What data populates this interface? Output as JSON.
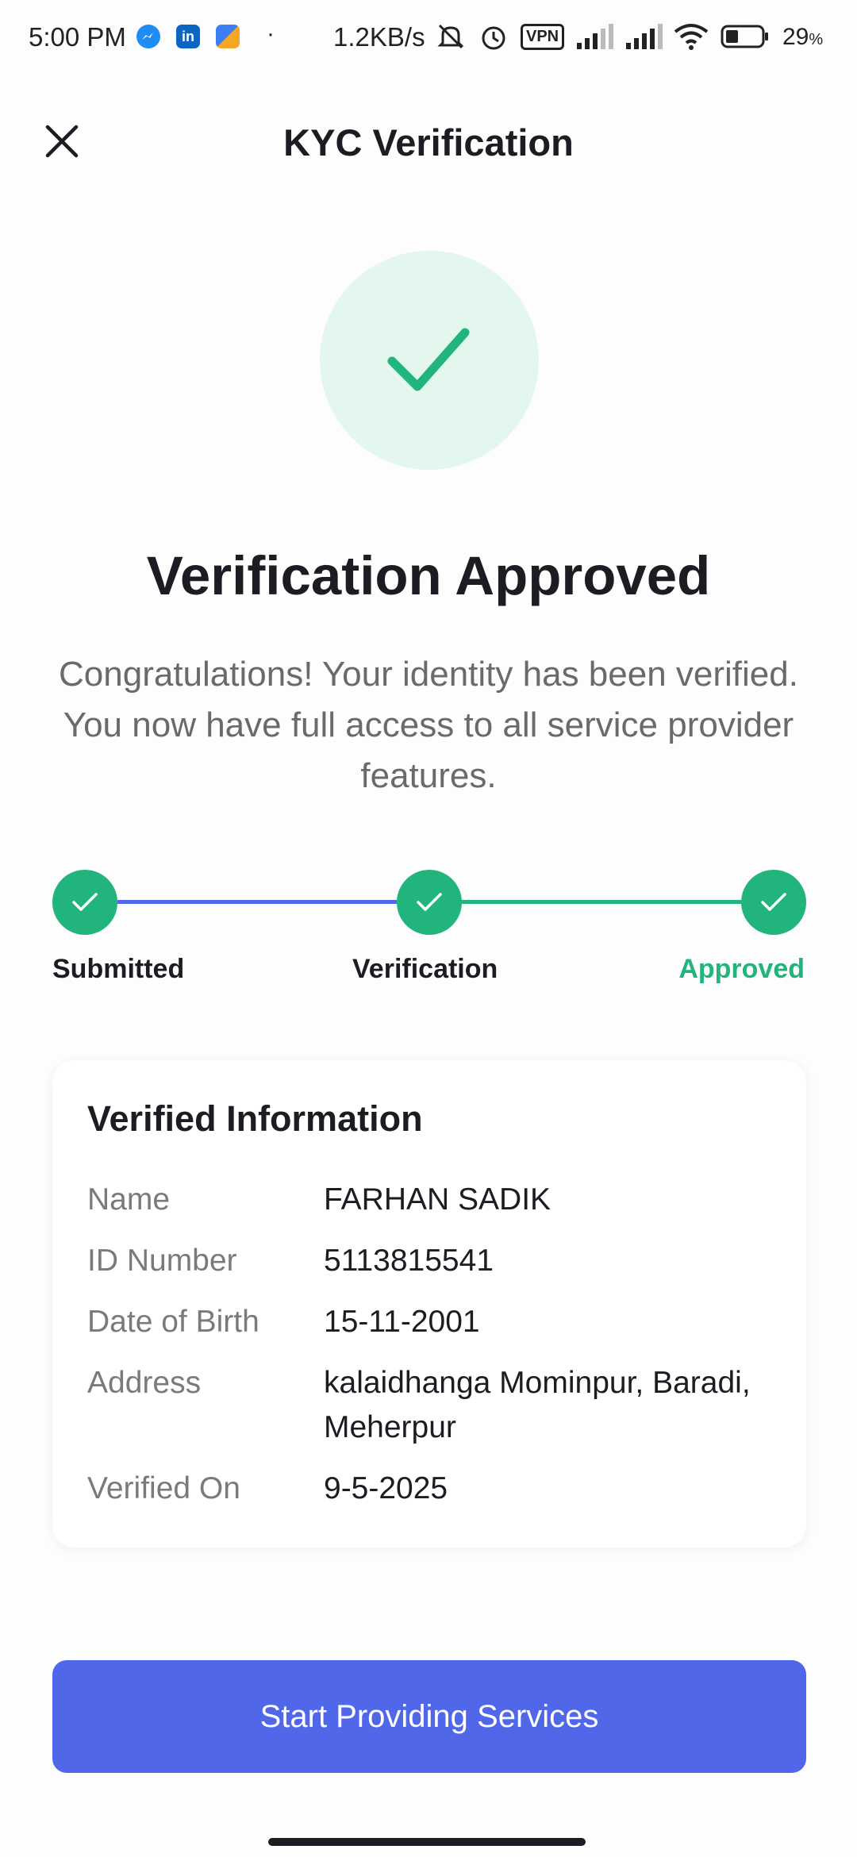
{
  "status_bar": {
    "time": "5:00 PM",
    "app_icons": [
      "messenger-icon",
      "linkedin-icon",
      "app-icon"
    ],
    "dot": "·",
    "network_speed": "1.2KB/s",
    "indicators": [
      "mute-icon",
      "alarm-icon",
      "vpn-icon",
      "signal-icon",
      "signal-icon",
      "wifi-icon",
      "battery-icon"
    ],
    "vpn_label": "VPN",
    "battery_percent": "29",
    "battery_unit": "%"
  },
  "header": {
    "title": "KYC Verification",
    "close_icon": "close-icon"
  },
  "status": {
    "icon": "checkmark-icon",
    "title": "Verification Approved",
    "message": "Congratulations! Your identity has been verified. You now have full access to all service provider features."
  },
  "stepper": {
    "steps": [
      {
        "label": "Submitted",
        "state": "complete"
      },
      {
        "label": "Verification",
        "state": "complete"
      },
      {
        "label": "Approved",
        "state": "complete-current"
      }
    ]
  },
  "verified_info": {
    "title": "Verified Information",
    "rows": [
      {
        "label": "Name",
        "value": "FARHAN SADIK"
      },
      {
        "label": "ID Number",
        "value": "5113815541"
      },
      {
        "label": "Date of Birth",
        "value": "15-11-2001"
      },
      {
        "label": "Address",
        "value": "kalaidhanga Mominpur, Baradi, Meherpur"
      },
      {
        "label": "Verified On",
        "value": "9-5-2025"
      }
    ]
  },
  "cta": {
    "label": "Start Providing Services"
  },
  "colors": {
    "primary": "#4f67e8",
    "success": "#21b57d",
    "success_bg": "#e4f7ef",
    "text_dark": "#1c1c22",
    "text_muted": "#6a6a6e"
  }
}
